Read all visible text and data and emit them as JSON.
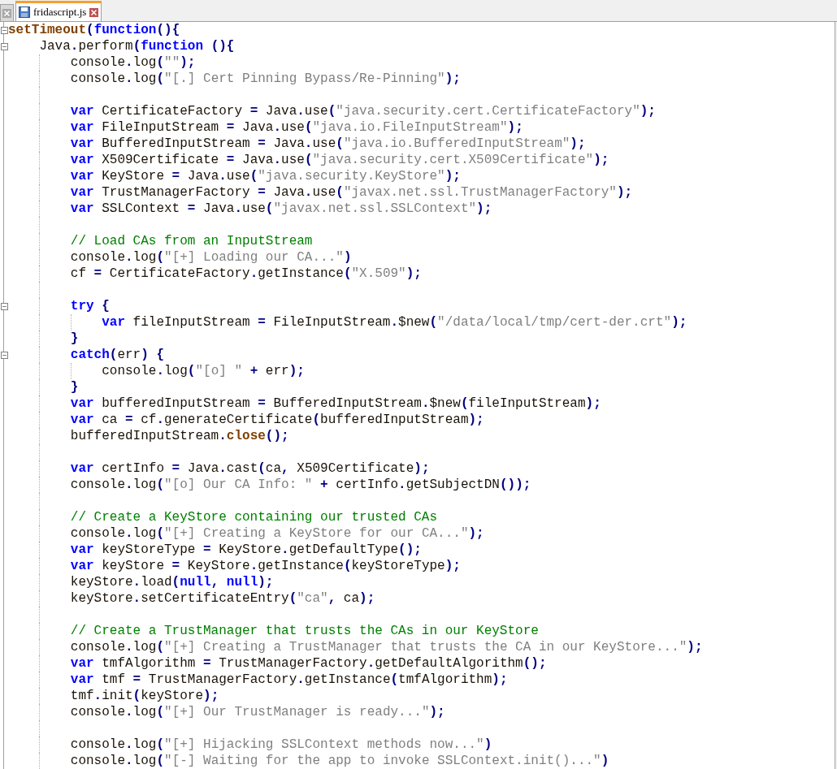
{
  "tabs": [
    {
      "selected": false
    },
    {
      "label": "fridascript.js",
      "selected": true
    }
  ],
  "editor": {
    "lines": [
      {
        "kind": "code",
        "tokens": [
          {
            "kind": "fn",
            "text": "setTimeout"
          },
          {
            "kind": "op",
            "text": "("
          },
          {
            "kind": "kw",
            "text": "function"
          },
          {
            "kind": "op",
            "text": "(){"
          }
        ],
        "children": [
          {
            "kind": "code",
            "tokens": [
              {
                "kind": "id",
                "text": "Java"
              },
              {
                "kind": "op",
                "text": "."
              },
              {
                "kind": "id",
                "text": "perform"
              },
              {
                "kind": "op",
                "text": "("
              },
              {
                "kind": "kw",
                "text": "function"
              },
              {
                "kind": "op",
                "text": " (){"
              }
            ],
            "children": [
              {
                "kind": "code",
                "tokens": [
                  {
                    "kind": "id",
                    "text": "console"
                  },
                  {
                    "kind": "op",
                    "text": "."
                  },
                  {
                    "kind": "id",
                    "text": "log"
                  },
                  {
                    "kind": "op",
                    "text": "("
                  },
                  {
                    "kind": "str",
                    "text": "\"\""
                  },
                  {
                    "kind": "op",
                    "text": ");"
                  }
                ]
              },
              {
                "kind": "code",
                "tokens": [
                  {
                    "kind": "id",
                    "text": "console"
                  },
                  {
                    "kind": "op",
                    "text": "."
                  },
                  {
                    "kind": "id",
                    "text": "log"
                  },
                  {
                    "kind": "op",
                    "text": "("
                  },
                  {
                    "kind": "str",
                    "text": "\"[.] Cert Pinning Bypass/Re-Pinning\""
                  },
                  {
                    "kind": "op",
                    "text": ");"
                  }
                ]
              },
              {
                "kind": "blank"
              },
              {
                "kind": "code",
                "tokens": [
                  {
                    "kind": "kw",
                    "text": "var"
                  },
                  {
                    "kind": "id",
                    "text": " CertificateFactory "
                  },
                  {
                    "kind": "op",
                    "text": "="
                  },
                  {
                    "kind": "id",
                    "text": " Java"
                  },
                  {
                    "kind": "op",
                    "text": "."
                  },
                  {
                    "kind": "id",
                    "text": "use"
                  },
                  {
                    "kind": "op",
                    "text": "("
                  },
                  {
                    "kind": "str",
                    "text": "\"java.security.cert.CertificateFactory\""
                  },
                  {
                    "kind": "op",
                    "text": ");"
                  }
                ]
              },
              {
                "kind": "code",
                "tokens": [
                  {
                    "kind": "kw",
                    "text": "var"
                  },
                  {
                    "kind": "id",
                    "text": " FileInputStream "
                  },
                  {
                    "kind": "op",
                    "text": "="
                  },
                  {
                    "kind": "id",
                    "text": " Java"
                  },
                  {
                    "kind": "op",
                    "text": "."
                  },
                  {
                    "kind": "id",
                    "text": "use"
                  },
                  {
                    "kind": "op",
                    "text": "("
                  },
                  {
                    "kind": "str",
                    "text": "\"java.io.FileInputStream\""
                  },
                  {
                    "kind": "op",
                    "text": ");"
                  }
                ]
              },
              {
                "kind": "code",
                "tokens": [
                  {
                    "kind": "kw",
                    "text": "var"
                  },
                  {
                    "kind": "id",
                    "text": " BufferedInputStream "
                  },
                  {
                    "kind": "op",
                    "text": "="
                  },
                  {
                    "kind": "id",
                    "text": " Java"
                  },
                  {
                    "kind": "op",
                    "text": "."
                  },
                  {
                    "kind": "id",
                    "text": "use"
                  },
                  {
                    "kind": "op",
                    "text": "("
                  },
                  {
                    "kind": "str",
                    "text": "\"java.io.BufferedInputStream\""
                  },
                  {
                    "kind": "op",
                    "text": ");"
                  }
                ]
              },
              {
                "kind": "code",
                "tokens": [
                  {
                    "kind": "kw",
                    "text": "var"
                  },
                  {
                    "kind": "id",
                    "text": " X509Certificate "
                  },
                  {
                    "kind": "op",
                    "text": "="
                  },
                  {
                    "kind": "id",
                    "text": " Java"
                  },
                  {
                    "kind": "op",
                    "text": "."
                  },
                  {
                    "kind": "id",
                    "text": "use"
                  },
                  {
                    "kind": "op",
                    "text": "("
                  },
                  {
                    "kind": "str",
                    "text": "\"java.security.cert.X509Certificate\""
                  },
                  {
                    "kind": "op",
                    "text": ");"
                  }
                ]
              },
              {
                "kind": "code",
                "tokens": [
                  {
                    "kind": "kw",
                    "text": "var"
                  },
                  {
                    "kind": "id",
                    "text": " KeyStore "
                  },
                  {
                    "kind": "op",
                    "text": "="
                  },
                  {
                    "kind": "id",
                    "text": " Java"
                  },
                  {
                    "kind": "op",
                    "text": "."
                  },
                  {
                    "kind": "id",
                    "text": "use"
                  },
                  {
                    "kind": "op",
                    "text": "("
                  },
                  {
                    "kind": "str",
                    "text": "\"java.security.KeyStore\""
                  },
                  {
                    "kind": "op",
                    "text": ");"
                  }
                ]
              },
              {
                "kind": "code",
                "tokens": [
                  {
                    "kind": "kw",
                    "text": "var"
                  },
                  {
                    "kind": "id",
                    "text": " TrustManagerFactory "
                  },
                  {
                    "kind": "op",
                    "text": "="
                  },
                  {
                    "kind": "id",
                    "text": " Java"
                  },
                  {
                    "kind": "op",
                    "text": "."
                  },
                  {
                    "kind": "id",
                    "text": "use"
                  },
                  {
                    "kind": "op",
                    "text": "("
                  },
                  {
                    "kind": "str",
                    "text": "\"javax.net.ssl.TrustManagerFactory\""
                  },
                  {
                    "kind": "op",
                    "text": ");"
                  }
                ]
              },
              {
                "kind": "code",
                "tokens": [
                  {
                    "kind": "kw",
                    "text": "var"
                  },
                  {
                    "kind": "id",
                    "text": " SSLContext "
                  },
                  {
                    "kind": "op",
                    "text": "="
                  },
                  {
                    "kind": "id",
                    "text": " Java"
                  },
                  {
                    "kind": "op",
                    "text": "."
                  },
                  {
                    "kind": "id",
                    "text": "use"
                  },
                  {
                    "kind": "op",
                    "text": "("
                  },
                  {
                    "kind": "str",
                    "text": "\"javax.net.ssl.SSLContext\""
                  },
                  {
                    "kind": "op",
                    "text": ");"
                  }
                ]
              },
              {
                "kind": "blank"
              },
              {
                "kind": "code",
                "tokens": [
                  {
                    "kind": "com",
                    "text": "// Load CAs from an InputStream"
                  }
                ]
              },
              {
                "kind": "code",
                "tokens": [
                  {
                    "kind": "id",
                    "text": "console"
                  },
                  {
                    "kind": "op",
                    "text": "."
                  },
                  {
                    "kind": "id",
                    "text": "log"
                  },
                  {
                    "kind": "op",
                    "text": "("
                  },
                  {
                    "kind": "str",
                    "text": "\"[+] Loading our CA...\""
                  },
                  {
                    "kind": "op",
                    "text": ")"
                  }
                ]
              },
              {
                "kind": "code",
                "tokens": [
                  {
                    "kind": "id",
                    "text": "cf "
                  },
                  {
                    "kind": "op",
                    "text": "="
                  },
                  {
                    "kind": "id",
                    "text": " CertificateFactory"
                  },
                  {
                    "kind": "op",
                    "text": "."
                  },
                  {
                    "kind": "id",
                    "text": "getInstance"
                  },
                  {
                    "kind": "op",
                    "text": "("
                  },
                  {
                    "kind": "str",
                    "text": "\"X.509\""
                  },
                  {
                    "kind": "op",
                    "text": ");"
                  }
                ]
              },
              {
                "kind": "blank"
              },
              {
                "kind": "code",
                "tokens": [
                  {
                    "kind": "kw",
                    "text": "try"
                  },
                  {
                    "kind": "op",
                    "text": " {"
                  }
                ],
                "children": [
                  {
                    "kind": "code",
                    "tokens": [
                      {
                        "kind": "kw",
                        "text": "var"
                      },
                      {
                        "kind": "id",
                        "text": " fileInputStream "
                      },
                      {
                        "kind": "op",
                        "text": "="
                      },
                      {
                        "kind": "id",
                        "text": " FileInputStream"
                      },
                      {
                        "kind": "op",
                        "text": "."
                      },
                      {
                        "kind": "id",
                        "text": "$new"
                      },
                      {
                        "kind": "op",
                        "text": "("
                      },
                      {
                        "kind": "str",
                        "text": "\"/data/local/tmp/cert-der.crt\""
                      },
                      {
                        "kind": "op",
                        "text": ");"
                      }
                    ]
                  }
                ]
              },
              {
                "kind": "code",
                "tokens": [
                  {
                    "kind": "op",
                    "text": "}"
                  }
                ]
              },
              {
                "kind": "code",
                "tokens": [
                  {
                    "kind": "kw",
                    "text": "catch"
                  },
                  {
                    "kind": "op",
                    "text": "("
                  },
                  {
                    "kind": "id",
                    "text": "err"
                  },
                  {
                    "kind": "op",
                    "text": ")"
                  },
                  {
                    "kind": "op",
                    "text": " {"
                  }
                ],
                "children": [
                  {
                    "kind": "code",
                    "tokens": [
                      {
                        "kind": "id",
                        "text": "console"
                      },
                      {
                        "kind": "op",
                        "text": "."
                      },
                      {
                        "kind": "id",
                        "text": "log"
                      },
                      {
                        "kind": "op",
                        "text": "("
                      },
                      {
                        "kind": "str",
                        "text": "\"[o] \""
                      },
                      {
                        "kind": "op",
                        "text": " +"
                      },
                      {
                        "kind": "id",
                        "text": " err"
                      },
                      {
                        "kind": "op",
                        "text": ");"
                      }
                    ]
                  }
                ]
              },
              {
                "kind": "code",
                "tokens": [
                  {
                    "kind": "op",
                    "text": "}"
                  }
                ]
              },
              {
                "kind": "code",
                "tokens": [
                  {
                    "kind": "kw",
                    "text": "var"
                  },
                  {
                    "kind": "id",
                    "text": " bufferedInputStream "
                  },
                  {
                    "kind": "op",
                    "text": "="
                  },
                  {
                    "kind": "id",
                    "text": " BufferedInputStream"
                  },
                  {
                    "kind": "op",
                    "text": "."
                  },
                  {
                    "kind": "id",
                    "text": "$new"
                  },
                  {
                    "kind": "op",
                    "text": "("
                  },
                  {
                    "kind": "id",
                    "text": "fileInputStream"
                  },
                  {
                    "kind": "op",
                    "text": ");"
                  }
                ]
              },
              {
                "kind": "code",
                "tokens": [
                  {
                    "kind": "kw",
                    "text": "var"
                  },
                  {
                    "kind": "id",
                    "text": " ca "
                  },
                  {
                    "kind": "op",
                    "text": "="
                  },
                  {
                    "kind": "id",
                    "text": " cf"
                  },
                  {
                    "kind": "op",
                    "text": "."
                  },
                  {
                    "kind": "id",
                    "text": "generateCertificate"
                  },
                  {
                    "kind": "op",
                    "text": "("
                  },
                  {
                    "kind": "id",
                    "text": "bufferedInputStream"
                  },
                  {
                    "kind": "op",
                    "text": ");"
                  }
                ]
              },
              {
                "kind": "code",
                "tokens": [
                  {
                    "kind": "id",
                    "text": "bufferedInputStream"
                  },
                  {
                    "kind": "op",
                    "text": "."
                  },
                  {
                    "kind": "fn",
                    "text": "close"
                  },
                  {
                    "kind": "op",
                    "text": "();"
                  }
                ]
              },
              {
                "kind": "blank"
              },
              {
                "kind": "code",
                "tokens": [
                  {
                    "kind": "kw",
                    "text": "var"
                  },
                  {
                    "kind": "id",
                    "text": " certInfo "
                  },
                  {
                    "kind": "op",
                    "text": "="
                  },
                  {
                    "kind": "id",
                    "text": " Java"
                  },
                  {
                    "kind": "op",
                    "text": "."
                  },
                  {
                    "kind": "id",
                    "text": "cast"
                  },
                  {
                    "kind": "op",
                    "text": "("
                  },
                  {
                    "kind": "id",
                    "text": "ca"
                  },
                  {
                    "kind": "op",
                    "text": ","
                  },
                  {
                    "kind": "id",
                    "text": " X509Certificate"
                  },
                  {
                    "kind": "op",
                    "text": ");"
                  }
                ]
              },
              {
                "kind": "code",
                "tokens": [
                  {
                    "kind": "id",
                    "text": "console"
                  },
                  {
                    "kind": "op",
                    "text": "."
                  },
                  {
                    "kind": "id",
                    "text": "log"
                  },
                  {
                    "kind": "op",
                    "text": "("
                  },
                  {
                    "kind": "str",
                    "text": "\"[o] Our CA Info: \""
                  },
                  {
                    "kind": "op",
                    "text": " +"
                  },
                  {
                    "kind": "id",
                    "text": " certInfo"
                  },
                  {
                    "kind": "op",
                    "text": "."
                  },
                  {
                    "kind": "id",
                    "text": "getSubjectDN"
                  },
                  {
                    "kind": "op",
                    "text": "());"
                  }
                ]
              },
              {
                "kind": "blank"
              },
              {
                "kind": "code",
                "tokens": [
                  {
                    "kind": "com",
                    "text": "// Create a KeyStore containing our trusted CAs"
                  }
                ]
              },
              {
                "kind": "code",
                "tokens": [
                  {
                    "kind": "id",
                    "text": "console"
                  },
                  {
                    "kind": "op",
                    "text": "."
                  },
                  {
                    "kind": "id",
                    "text": "log"
                  },
                  {
                    "kind": "op",
                    "text": "("
                  },
                  {
                    "kind": "str",
                    "text": "\"[+] Creating a KeyStore for our CA...\""
                  },
                  {
                    "kind": "op",
                    "text": ");"
                  }
                ]
              },
              {
                "kind": "code",
                "tokens": [
                  {
                    "kind": "kw",
                    "text": "var"
                  },
                  {
                    "kind": "id",
                    "text": " keyStoreType "
                  },
                  {
                    "kind": "op",
                    "text": "="
                  },
                  {
                    "kind": "id",
                    "text": " KeyStore"
                  },
                  {
                    "kind": "op",
                    "text": "."
                  },
                  {
                    "kind": "id",
                    "text": "getDefaultType"
                  },
                  {
                    "kind": "op",
                    "text": "();"
                  }
                ]
              },
              {
                "kind": "code",
                "tokens": [
                  {
                    "kind": "kw",
                    "text": "var"
                  },
                  {
                    "kind": "id",
                    "text": " keyStore "
                  },
                  {
                    "kind": "op",
                    "text": "="
                  },
                  {
                    "kind": "id",
                    "text": " KeyStore"
                  },
                  {
                    "kind": "op",
                    "text": "."
                  },
                  {
                    "kind": "id",
                    "text": "getInstance"
                  },
                  {
                    "kind": "op",
                    "text": "("
                  },
                  {
                    "kind": "id",
                    "text": "keyStoreType"
                  },
                  {
                    "kind": "op",
                    "text": ");"
                  }
                ]
              },
              {
                "kind": "code",
                "tokens": [
                  {
                    "kind": "id",
                    "text": "keyStore"
                  },
                  {
                    "kind": "op",
                    "text": "."
                  },
                  {
                    "kind": "id",
                    "text": "load"
                  },
                  {
                    "kind": "op",
                    "text": "("
                  },
                  {
                    "kind": "kw",
                    "text": "null"
                  },
                  {
                    "kind": "op",
                    "text": ", "
                  },
                  {
                    "kind": "kw",
                    "text": "null"
                  },
                  {
                    "kind": "op",
                    "text": ");"
                  }
                ]
              },
              {
                "kind": "code",
                "tokens": [
                  {
                    "kind": "id",
                    "text": "keyStore"
                  },
                  {
                    "kind": "op",
                    "text": "."
                  },
                  {
                    "kind": "id",
                    "text": "setCertificateEntry"
                  },
                  {
                    "kind": "op",
                    "text": "("
                  },
                  {
                    "kind": "str",
                    "text": "\"ca\""
                  },
                  {
                    "kind": "op",
                    "text": ","
                  },
                  {
                    "kind": "id",
                    "text": " ca"
                  },
                  {
                    "kind": "op",
                    "text": ");"
                  }
                ]
              },
              {
                "kind": "blank"
              },
              {
                "kind": "code",
                "tokens": [
                  {
                    "kind": "com",
                    "text": "// Create a TrustManager that trusts the CAs in our KeyStore"
                  }
                ]
              },
              {
                "kind": "code",
                "tokens": [
                  {
                    "kind": "id",
                    "text": "console"
                  },
                  {
                    "kind": "op",
                    "text": "."
                  },
                  {
                    "kind": "id",
                    "text": "log"
                  },
                  {
                    "kind": "op",
                    "text": "("
                  },
                  {
                    "kind": "str",
                    "text": "\"[+] Creating a TrustManager that trusts the CA in our KeyStore...\""
                  },
                  {
                    "kind": "op",
                    "text": ");"
                  }
                ]
              },
              {
                "kind": "code",
                "tokens": [
                  {
                    "kind": "kw",
                    "text": "var"
                  },
                  {
                    "kind": "id",
                    "text": " tmfAlgorithm "
                  },
                  {
                    "kind": "op",
                    "text": "="
                  },
                  {
                    "kind": "id",
                    "text": " TrustManagerFactory"
                  },
                  {
                    "kind": "op",
                    "text": "."
                  },
                  {
                    "kind": "id",
                    "text": "getDefaultAlgorithm"
                  },
                  {
                    "kind": "op",
                    "text": "();"
                  }
                ]
              },
              {
                "kind": "code",
                "tokens": [
                  {
                    "kind": "kw",
                    "text": "var"
                  },
                  {
                    "kind": "id",
                    "text": " tmf "
                  },
                  {
                    "kind": "op",
                    "text": "="
                  },
                  {
                    "kind": "id",
                    "text": " TrustManagerFactory"
                  },
                  {
                    "kind": "op",
                    "text": "."
                  },
                  {
                    "kind": "id",
                    "text": "getInstance"
                  },
                  {
                    "kind": "op",
                    "text": "("
                  },
                  {
                    "kind": "id",
                    "text": "tmfAlgorithm"
                  },
                  {
                    "kind": "op",
                    "text": ");"
                  }
                ]
              },
              {
                "kind": "code",
                "tokens": [
                  {
                    "kind": "id",
                    "text": "tmf"
                  },
                  {
                    "kind": "op",
                    "text": "."
                  },
                  {
                    "kind": "id",
                    "text": "init"
                  },
                  {
                    "kind": "op",
                    "text": "("
                  },
                  {
                    "kind": "id",
                    "text": "keyStore"
                  },
                  {
                    "kind": "op",
                    "text": ");"
                  }
                ]
              },
              {
                "kind": "code",
                "tokens": [
                  {
                    "kind": "id",
                    "text": "console"
                  },
                  {
                    "kind": "op",
                    "text": "."
                  },
                  {
                    "kind": "id",
                    "text": "log"
                  },
                  {
                    "kind": "op",
                    "text": "("
                  },
                  {
                    "kind": "str",
                    "text": "\"[+] Our TrustManager is ready...\""
                  },
                  {
                    "kind": "op",
                    "text": ");"
                  }
                ]
              },
              {
                "kind": "blank"
              },
              {
                "kind": "code",
                "tokens": [
                  {
                    "kind": "id",
                    "text": "console"
                  },
                  {
                    "kind": "op",
                    "text": "."
                  },
                  {
                    "kind": "id",
                    "text": "log"
                  },
                  {
                    "kind": "op",
                    "text": "("
                  },
                  {
                    "kind": "str",
                    "text": "\"[+] Hijacking SSLContext methods now...\""
                  },
                  {
                    "kind": "op",
                    "text": ")"
                  }
                ]
              },
              {
                "kind": "code",
                "tokens": [
                  {
                    "kind": "id",
                    "text": "console"
                  },
                  {
                    "kind": "op",
                    "text": "."
                  },
                  {
                    "kind": "id",
                    "text": "log"
                  },
                  {
                    "kind": "op",
                    "text": "("
                  },
                  {
                    "kind": "str",
                    "text": "\"[-] Waiting for the app to invoke SSLContext.init()...\""
                  },
                  {
                    "kind": "op",
                    "text": ")"
                  }
                ]
              }
            ]
          }
        ]
      }
    ]
  }
}
